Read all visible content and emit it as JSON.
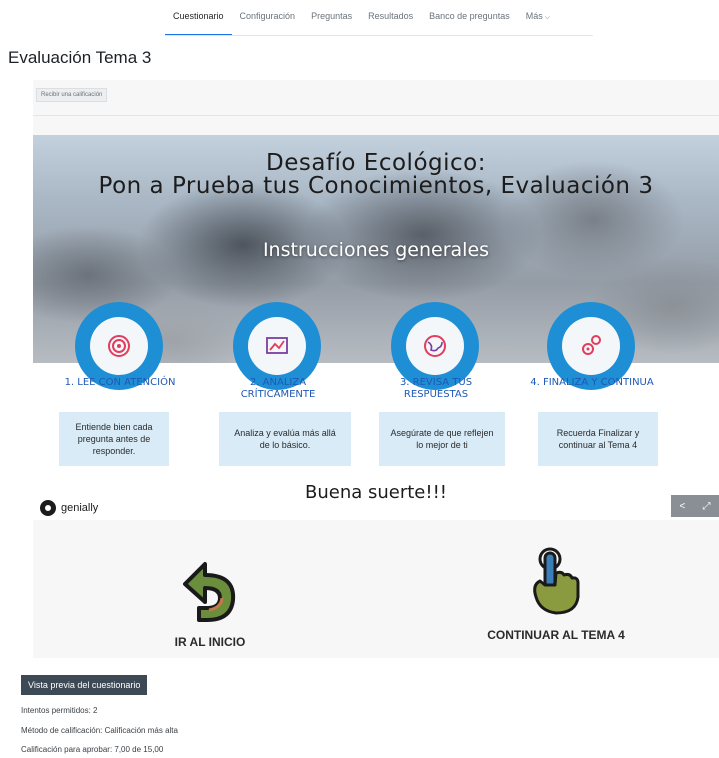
{
  "nav": {
    "tabs": [
      {
        "label": "Cuestionario",
        "active": true
      },
      {
        "label": "Configuración",
        "active": false
      },
      {
        "label": "Preguntas",
        "active": false
      },
      {
        "label": "Resultados",
        "active": false
      },
      {
        "label": "Banco de preguntas",
        "active": false
      },
      {
        "label": "Más",
        "active": false,
        "icon": "chevron-down-icon"
      }
    ],
    "active_color": "#1a73e8"
  },
  "page_title": "Evaluación Tema 3",
  "grade_button": "Recibir una calificación",
  "genially": {
    "title_line1": "Desafío Ecológico:",
    "title_line2": "Pon a Prueba tus Conocimientos, Evaluación 3",
    "instructions_heading": "Instrucciones generales",
    "steps": [
      {
        "title": "1. LEE CON ATENCIÓN",
        "text": "Entiende bien cada pregunta antes de responder.",
        "icon": "target-icon"
      },
      {
        "title": "2. ANALIZA CRÍTICAMENTE",
        "text": "Analiza y evalúa más allá de lo básico.",
        "icon": "chart-icon"
      },
      {
        "title": "3. REVISA TUS RESPUESTAS",
        "text": "Asegúrate de que reflejen lo mejor de ti",
        "icon": "globe-icon"
      },
      {
        "title": "4. FINALIZA Y CONTINUA",
        "text": "Recuerda Finalizar y continuar al Tema 4",
        "icon": "gears-icon"
      }
    ],
    "good_luck": "Buena suerte!!!",
    "brand": "genially",
    "ring_color": "#1e8fd4",
    "step_title_color": "#1f58b5",
    "card_color": "#d8ebf7"
  },
  "buttons": {
    "home_label": "IR AL INICIO",
    "next_label": "CONTINUAR AL TEMA 4",
    "preview_label": "Vista previa del cuestionario"
  },
  "info": {
    "attempts": "Intentos permitidos: 2",
    "method": "Método de calificación: Calificación más alta",
    "passing": "Calificación para aprobar: 7,00 de 15,00"
  }
}
